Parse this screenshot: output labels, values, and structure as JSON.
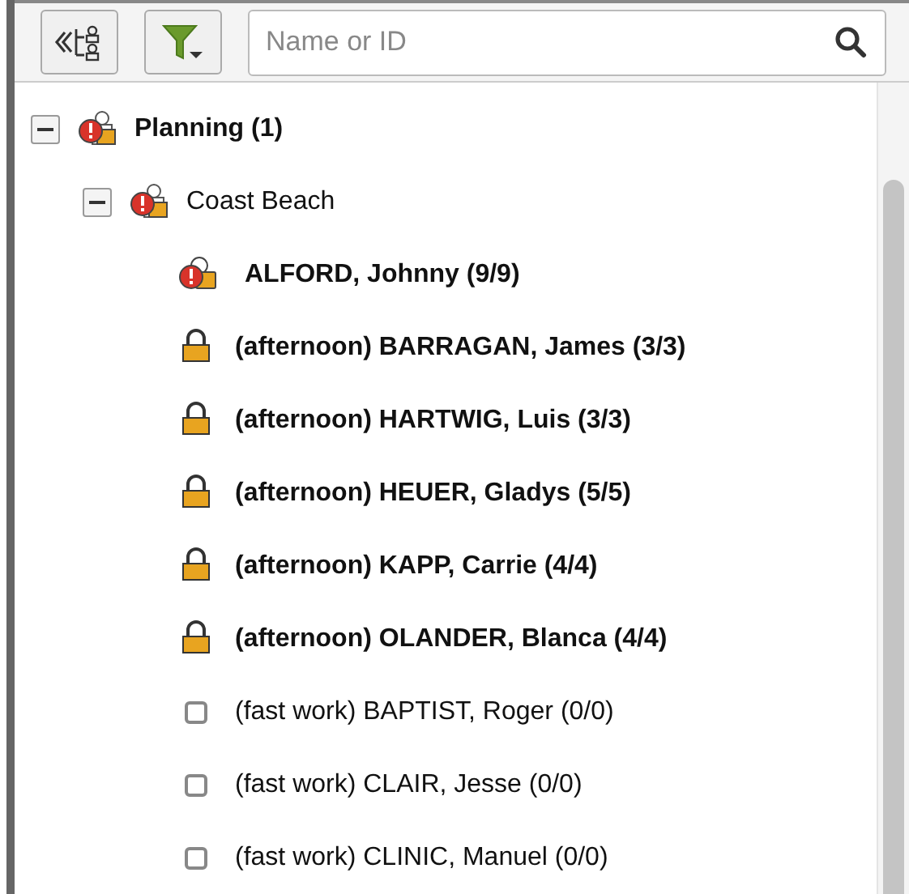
{
  "toolbar": {
    "search": {
      "placeholder": "Name or ID"
    }
  },
  "tree": [
    {
      "label": "Planning (1)",
      "kind": "group",
      "bold": true,
      "expanded": true,
      "children": [
        {
          "label": "Coast Beach",
          "kind": "group",
          "bold": false,
          "expanded": true,
          "children": [
            {
              "label": "ALFORD, Johnny (9/9)",
              "kind": "alert",
              "bold": true
            },
            {
              "label": "(afternoon) BARRAGAN, James (3/3)",
              "kind": "lock",
              "bold": true
            },
            {
              "label": "(afternoon) HARTWIG, Luis (3/3)",
              "kind": "lock",
              "bold": true
            },
            {
              "label": "(afternoon) HEUER, Gladys (5/5)",
              "kind": "lock",
              "bold": true
            },
            {
              "label": "(afternoon) KAPP, Carrie (4/4)",
              "kind": "lock",
              "bold": true
            },
            {
              "label": "(afternoon) OLANDER, Blanca (4/4)",
              "kind": "lock",
              "bold": true
            },
            {
              "label": "(fast work) BAPTIST, Roger (0/0)",
              "kind": "empty",
              "bold": false
            },
            {
              "label": "(fast work) CLAIR, Jesse (0/0)",
              "kind": "empty",
              "bold": false
            },
            {
              "label": "(fast work) CLINIC, Manuel (0/0)",
              "kind": "empty",
              "bold": false
            }
          ]
        }
      ]
    }
  ]
}
